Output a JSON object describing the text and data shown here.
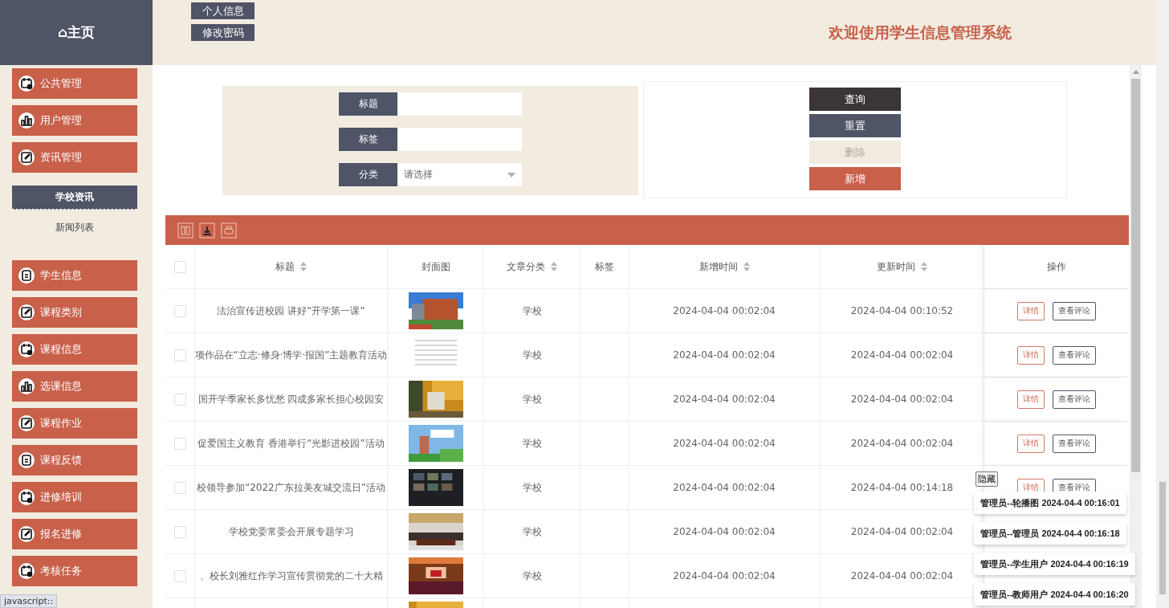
{
  "header": {
    "home": "⌂主页",
    "buttons": [
      "个人信息",
      "修改密码"
    ],
    "welcome": "欢迎使用学生信息管理系统"
  },
  "sidebar": {
    "items_top": [
      {
        "label": "公共管理",
        "kind": "calendar"
      },
      {
        "label": "用户管理",
        "kind": "chart"
      },
      {
        "label": "资讯管理",
        "kind": "edit"
      }
    ],
    "group": {
      "label": "学校资讯",
      "children": [
        "新闻列表"
      ]
    },
    "items_bottom": [
      {
        "label": "学生信息",
        "kind": "clipboard"
      },
      {
        "label": "课程类别",
        "kind": "edit"
      },
      {
        "label": "课程信息",
        "kind": "calendar"
      },
      {
        "label": "选课信息",
        "kind": "chart"
      },
      {
        "label": "课程作业",
        "kind": "edit"
      },
      {
        "label": "课程反馈",
        "kind": "clipboard"
      },
      {
        "label": "进修培训",
        "kind": "calendar"
      },
      {
        "label": "报名进修",
        "kind": "edit"
      },
      {
        "label": "考核任务",
        "kind": "calendar"
      }
    ]
  },
  "search": {
    "fields": [
      {
        "label": "标题",
        "kind": "text"
      },
      {
        "label": "标签",
        "kind": "text"
      },
      {
        "label": "分类",
        "kind": "select",
        "placeholder": "请选择"
      }
    ],
    "buttons": [
      {
        "label": "查询",
        "kind": "query",
        "disabled": false
      },
      {
        "label": "重置",
        "kind": "reset",
        "disabled": false
      },
      {
        "label": "删除",
        "kind": "delete",
        "disabled": true
      },
      {
        "label": "新增",
        "kind": "add",
        "disabled": false
      }
    ]
  },
  "table": {
    "select_all": false,
    "columns": [
      {
        "label": "标题",
        "sortable": true
      },
      {
        "label": "封面图",
        "sortable": false
      },
      {
        "label": "文章分类",
        "sortable": true
      },
      {
        "label": "标签",
        "sortable": false
      },
      {
        "label": "新增时间",
        "sortable": true
      },
      {
        "label": "更新时间",
        "sortable": true
      },
      {
        "label": "操作",
        "sortable": false
      }
    ],
    "rows": [
      {
        "checked": false,
        "title": "法治宣传进校园 讲好“开学第一课”",
        "category": "学校",
        "created": "2024-04-04 00:02:04",
        "updated": "2024-04-04 00:10:52",
        "actions": [
          "详情",
          "查看评论"
        ]
      },
      {
        "checked": false,
        "title": "项作品在“立志·修身·博学·报国”主题教育活动",
        "category": "学校",
        "created": "2024-04-04 00:02:04",
        "updated": "2024-04-04 00:02:04",
        "actions": [
          "详情",
          "查看评论"
        ]
      },
      {
        "checked": false,
        "title": "国开学季家长多忧愁 四成多家长担心校园安",
        "category": "学校",
        "created": "2024-04-04 00:02:04",
        "updated": "2024-04-04 00:02:04",
        "actions": [
          "详情",
          "查看评论"
        ]
      },
      {
        "checked": false,
        "title": "促爱国主义教育 香港举行“光影进校园”活动",
        "category": "学校",
        "created": "2024-04-04 00:02:04",
        "updated": "2024-04-04 00:02:04",
        "actions": [
          "详情",
          "查看评论"
        ]
      },
      {
        "checked": false,
        "title": "校领导参加“2022广东拉美友城交流日”活动",
        "category": "学校",
        "created": "2024-04-04 00:02:04",
        "updated": "2024-04-04 00:14:18",
        "actions": [
          "详情",
          "查看评论"
        ]
      },
      {
        "checked": false,
        "title": "学校党委常委会开展专题学习",
        "category": "学校",
        "created": "2024-04-04 00:02:04",
        "updated": "2024-04-04 00:02:04"
      },
      {
        "checked": false,
        "title": "、校长刘雅红作学习宣传贯彻党的二十大精",
        "category": "学校",
        "created": "2024-04-04 00:02:04",
        "updated": "2024-04-04 00:02:04"
      },
      {
        "kind": "picture"
      }
    ]
  },
  "notifications": {
    "hide_button": "隐藏",
    "items": [
      "管理员--轮播图 2024-04-4 00:16:01",
      "管理员--管理员 2024-04-4 00:16:18",
      "管理员--学生用户 2024-04-4 00:16:19",
      "管理员--教师用户 2024-04-4 00:16:20"
    ]
  },
  "status_bubble": "javascript::"
}
